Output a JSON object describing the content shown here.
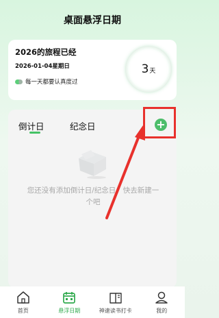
{
  "header": {
    "title": "桌面悬浮日期"
  },
  "top_card": {
    "trip_title": "2026的旅程已经",
    "date": "2026-01-04星期日",
    "tip": "每一天都要认真度过",
    "days": "3",
    "days_unit": "天"
  },
  "list_card": {
    "tabs": [
      {
        "label": "倒计日",
        "active": true
      },
      {
        "label": "纪念日",
        "active": false
      }
    ],
    "add_symbol": "+",
    "empty_text": "您还没有添加倒计日/纪念日，快去新建一个吧"
  },
  "bottom_nav": {
    "items": [
      {
        "label": "首页",
        "icon": "home-icon",
        "active": false
      },
      {
        "label": "悬浮日期",
        "icon": "calendar-icon",
        "active": true
      },
      {
        "label": "神速读书打卡",
        "icon": "book-icon",
        "active": false
      },
      {
        "label": "我的",
        "icon": "profile-icon",
        "active": false
      }
    ]
  },
  "colors": {
    "accent_green": "#4dbd6a",
    "highlight_red": "#e8312c",
    "background_green": "#d8f5df"
  }
}
